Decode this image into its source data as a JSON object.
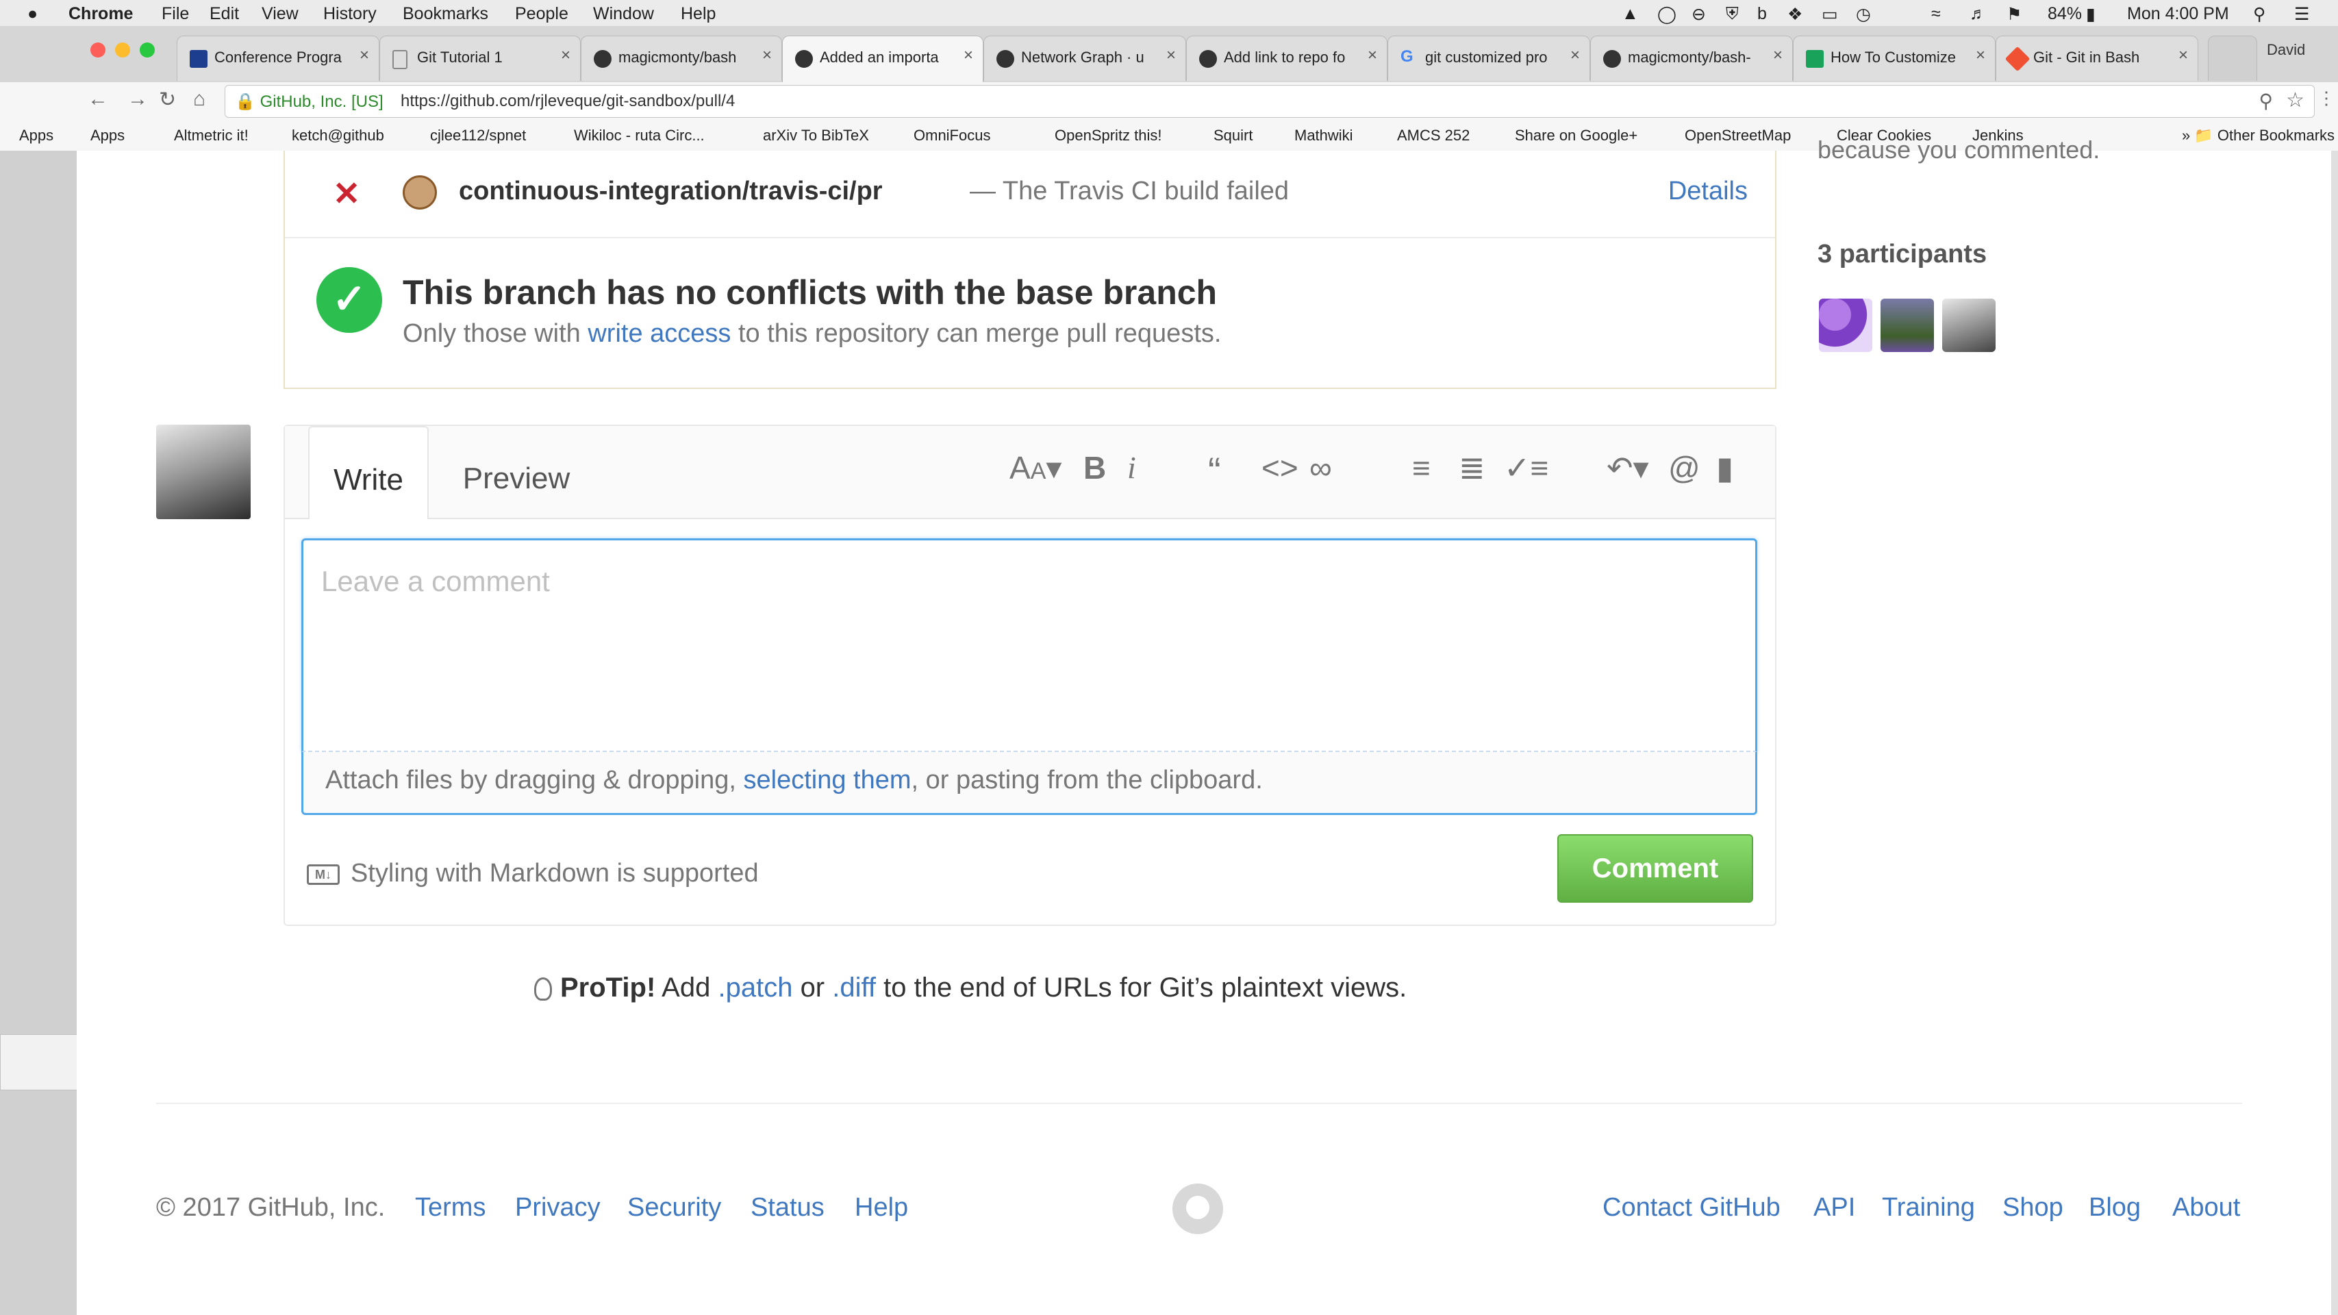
{
  "menubar": {
    "apple": "",
    "items": [
      "Chrome",
      "File",
      "Edit",
      "View",
      "History",
      "Bookmarks",
      "People",
      "Window",
      "Help"
    ],
    "battery": "84%",
    "clock": "Mon 4:00 PM"
  },
  "tabs": [
    {
      "title": "Conference Progra"
    },
    {
      "title": "Git Tutorial 1"
    },
    {
      "title": "magicmonty/bash"
    },
    {
      "title": "Added an importa"
    },
    {
      "title": "Network Graph · u"
    },
    {
      "title": "Add link to repo fo"
    },
    {
      "title": "git customized pro"
    },
    {
      "title": "magicmonty/bash-"
    },
    {
      "title": "How To Customize"
    },
    {
      "title": "Git - Git in Bash"
    }
  ],
  "profile": "David",
  "address": {
    "security": "GitHub, Inc. [US]",
    "url": "https://github.com/rjleveque/git-sandbox/pull/4"
  },
  "bookmarks": [
    "Apps",
    "Altmetric it!",
    "ketch@github",
    "cjlee112/spnet",
    "Wikiloc - ruta Circ...",
    "arXiv To BibTeX",
    "OmniFocus",
    "OpenSpritz this!",
    "Squirt",
    "Mathwiki",
    "AMCS 252",
    "Share on Google+",
    "OpenStreetMap",
    "Clear Cookies",
    "Jenkins"
  ],
  "other_bookmarks": "Other Bookmarks",
  "status_check": {
    "context": "continuous-integration/travis-ci/pr",
    "separator": "—",
    "description": "The Travis CI build failed",
    "details": "Details"
  },
  "merge": {
    "title": "This branch has no conflicts with the base branch",
    "sub_before": "Only those with",
    "sub_link": "write access",
    "sub_after": "to this repository can merge pull requests."
  },
  "sidebar": {
    "fragment": "because you commented.",
    "participants": "3 participants"
  },
  "comment": {
    "tab_write": "Write",
    "tab_preview": "Preview",
    "placeholder": "Leave a comment",
    "attach_before": "Attach files by dragging & dropping,",
    "attach_link": "selecting them",
    "attach_after": ", or pasting from the clipboard.",
    "markdown_badge": "M↓",
    "markdown": "Styling with Markdown is supported",
    "button": "Comment"
  },
  "protip": {
    "label": "ProTip!",
    "t1": "Add",
    "patch": ".patch",
    "or": "or",
    "diff": ".diff",
    "t2": "to the end of URLs for Git’s plaintext views."
  },
  "footer": {
    "copyright": "© 2017 GitHub, Inc.",
    "left_links": [
      "Terms",
      "Privacy",
      "Security",
      "Status",
      "Help"
    ],
    "right_links": [
      "Contact GitHub",
      "API",
      "Training",
      "Shop",
      "Blog",
      "About"
    ]
  },
  "colors": {
    "link": "#4078c0",
    "success": "#2cbe4e",
    "failure": "#cb2431",
    "button": "#60b044",
    "focus": "#51a7e8"
  }
}
